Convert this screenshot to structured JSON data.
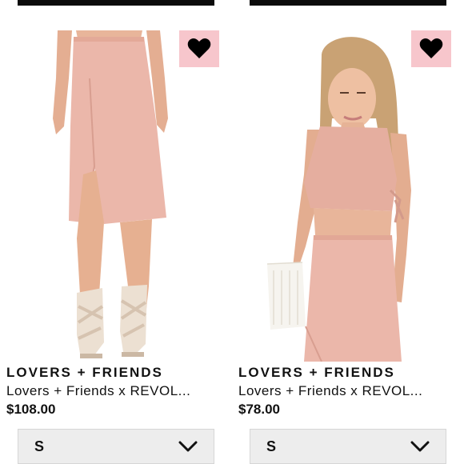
{
  "products": [
    {
      "brand": "LOVERS + FRIENDS",
      "title": "Lovers + Friends x REVOL...",
      "price": "$108.00",
      "size": "S",
      "image_alt": "pink midi skirt with slit",
      "favorite_icon": "heart-icon",
      "dropdown_icon": "chevron-down-icon"
    },
    {
      "brand": "LOVERS + FRIENDS",
      "title": "Lovers + Friends x REVOL...",
      "price": "$78.00",
      "size": "S",
      "image_alt": "pink crop top and skirt set",
      "favorite_icon": "heart-icon",
      "dropdown_icon": "chevron-down-icon"
    }
  ],
  "colors": {
    "favorite_bg": "#f7c6cc",
    "garment": "#e9b1a5",
    "skin": "#e8b59a"
  }
}
